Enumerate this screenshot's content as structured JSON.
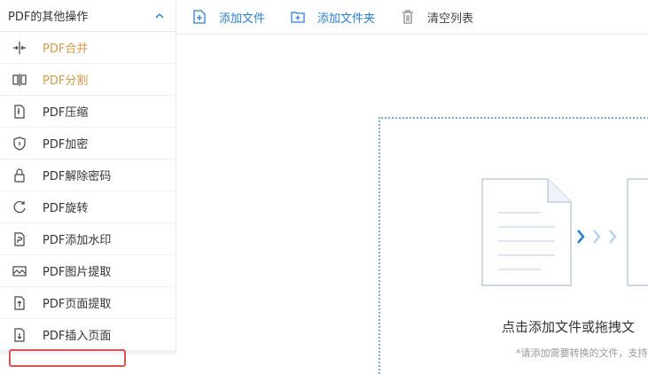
{
  "sidebar": {
    "header": "PDF的其他操作",
    "items": [
      {
        "label": "PDF合并",
        "icon": "merge-icon"
      },
      {
        "label": "PDF分割",
        "icon": "split-icon"
      },
      {
        "label": "PDF压缩",
        "icon": "compress-icon"
      },
      {
        "label": "PDF加密",
        "icon": "shield-icon"
      },
      {
        "label": "PDF解除密码",
        "icon": "lock-icon"
      },
      {
        "label": "PDF旋转",
        "icon": "rotate-icon"
      },
      {
        "label": "PDF添加水印",
        "icon": "watermark-icon"
      },
      {
        "label": "PDF图片提取",
        "icon": "image-icon"
      },
      {
        "label": "PDF页面提取",
        "icon": "page-extract-icon"
      },
      {
        "label": "PDF插入页面",
        "icon": "page-insert-icon"
      }
    ],
    "highlight_color": "#d39a4a"
  },
  "toolbar": {
    "add_file": "添加文件",
    "add_folder": "添加文件夹",
    "clear_list": "清空列表"
  },
  "dropzone": {
    "main_text": "点击添加文件或拖拽文",
    "sub_text": "*请添加需要转换的文件，支持"
  },
  "colors": {
    "accent": "#2a7fd3",
    "border": "#7ea6cf"
  }
}
